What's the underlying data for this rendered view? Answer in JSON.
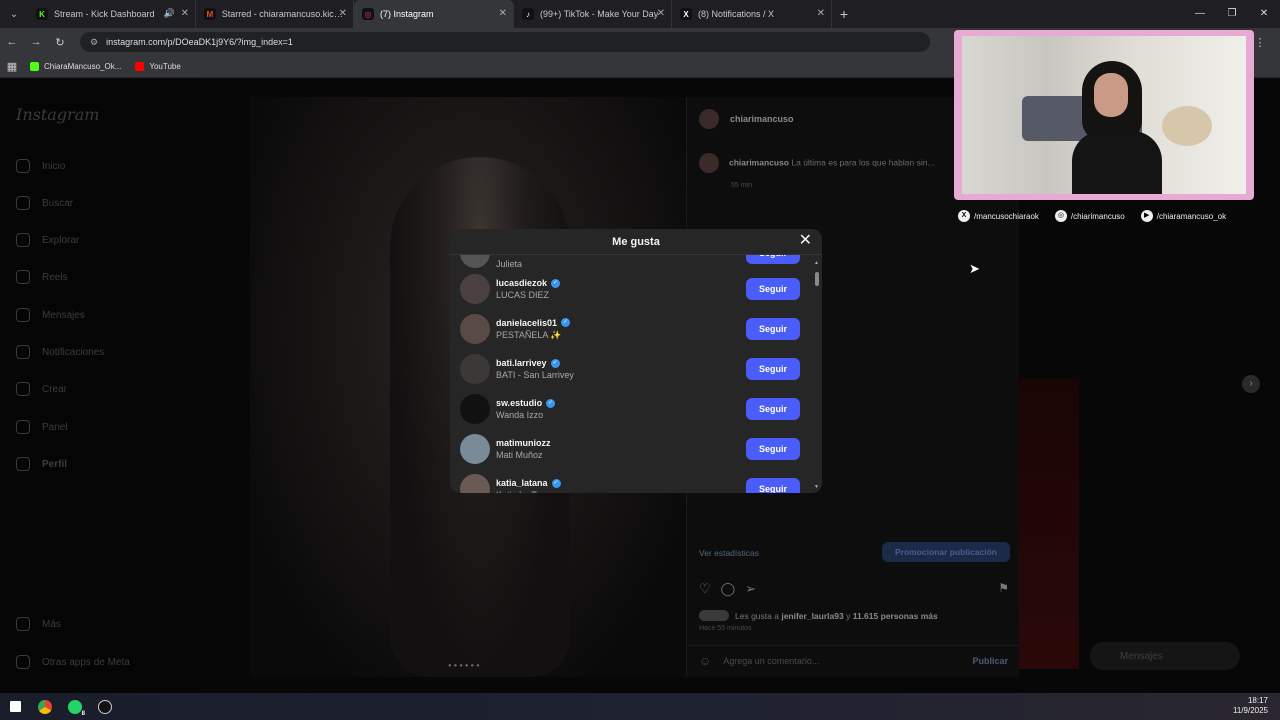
{
  "browser": {
    "tabs": [
      {
        "label": "Stream - Kick Dashboard",
        "favicon": "K",
        "color": "#53fc18"
      },
      {
        "label": "Starred - chiaramancuso.kick@",
        "favicon": "M",
        "color": "#ea4335"
      },
      {
        "label": "(7) Instagram",
        "favicon": "◎",
        "color": "#e1306c",
        "active": true
      },
      {
        "label": "(99+) TikTok - Make Your Day",
        "favicon": "♪",
        "color": "#ffffff"
      },
      {
        "label": "(8) Notifications / X",
        "favicon": "X",
        "color": "#ffffff"
      }
    ],
    "url": "instagram.com/p/DOeaDK1j9Y6/?img_index=1",
    "bookmarks": [
      {
        "label": "ChiaraMancuso_Ok...",
        "color": "#53fc18"
      },
      {
        "label": "YouTube",
        "color": "#ff0000"
      }
    ]
  },
  "instagram": {
    "logo": "Instagram",
    "nav": [
      "Inicio",
      "Buscar",
      "Explorar",
      "Reels",
      "Mensajes",
      "Notificaciones",
      "Crear",
      "Panel",
      "Perfil"
    ],
    "more": "Más",
    "meta_apps": "Otras apps de Meta",
    "post": {
      "username": "chiarimancuso",
      "caption": "La última es para los que hablan sin...",
      "time": "55 min",
      "stats_link": "Ver estadísticas",
      "promote": "Promocionar publicación",
      "likes_prefix": "Les gusta a",
      "likes_user": "jenifer_laurla93",
      "likes_mid": "y",
      "likes_count": "11.615 personas más",
      "ago": "Hace 55 minutos",
      "comment_placeholder": "Agrega un comentario...",
      "publish": "Publicar"
    },
    "messages_pill": "Mensajes"
  },
  "likes_modal": {
    "title": "Me gusta",
    "partial_top": "Julieta",
    "follow_label": "Seguir",
    "users": [
      {
        "username": "lucasdiezok",
        "name": "LUCAS DIEZ",
        "verified": true,
        "avatar": "#4a4040"
      },
      {
        "username": "danielacelis01",
        "name": "PESTAÑELA ✨",
        "verified": true,
        "avatar": "#5a4a46"
      },
      {
        "username": "bati.larrivey",
        "name": "BATI - San Larrivey",
        "verified": true,
        "avatar": "#3c3838"
      },
      {
        "username": "sw.estudio",
        "name": "Wanda Izzo",
        "verified": true,
        "avatar": "#111111"
      },
      {
        "username": "matimuniozz",
        "name": "Mati Muñoz",
        "verified": false,
        "avatar": "#7a8a96"
      },
      {
        "username": "katia_latana",
        "name": "Katia La Tana",
        "verified": true,
        "avatar": "#6a5a56"
      }
    ]
  },
  "overlay": {
    "socials": [
      {
        "icon": "x-icon",
        "glyph": "X",
        "label": "/mancusochiaraok"
      },
      {
        "icon": "instagram-icon",
        "glyph": "◎",
        "label": "/chiarimancuso"
      },
      {
        "icon": "youtube-icon",
        "glyph": "▶",
        "label": "/chiaramancuso_ok"
      }
    ]
  },
  "taskbar": {
    "time": "18:17",
    "date": "11/9/2025",
    "whatsapp_badge": "8"
  }
}
